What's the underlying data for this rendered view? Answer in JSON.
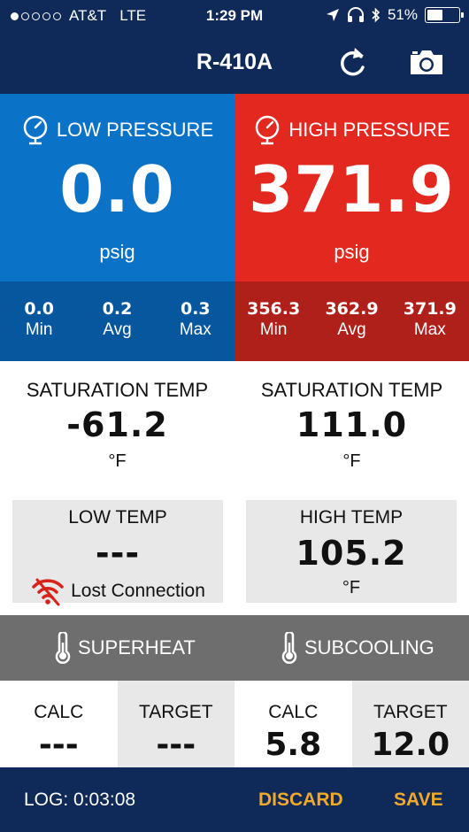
{
  "status_bar": {
    "carrier": "AT&T",
    "network": "LTE",
    "time": "1:29 PM",
    "battery": "51%",
    "battery_level": 0.51,
    "signal_dots_filled": 1,
    "signal_dots_total": 5,
    "icons": [
      "location-arrow-icon",
      "headphones-icon",
      "bluetooth-icon",
      "battery-icon"
    ]
  },
  "nav": {
    "title": "R-410A",
    "icons": [
      "refresh-icon",
      "camera-icon"
    ]
  },
  "low_pressure": {
    "label": "LOW PRESSURE",
    "value": "0.0",
    "unit": "psig",
    "stats": [
      {
        "value": "0.0",
        "label": "Min"
      },
      {
        "value": "0.2",
        "label": "Avg"
      },
      {
        "value": "0.3",
        "label": "Max"
      }
    ]
  },
  "high_pressure": {
    "label": "HIGH PRESSURE",
    "value": "371.9",
    "unit": "psig",
    "stats": [
      {
        "value": "356.3",
        "label": "Min"
      },
      {
        "value": "362.9",
        "label": "Avg"
      },
      {
        "value": "371.9",
        "label": "Max"
      }
    ]
  },
  "saturation": {
    "low": {
      "label": "SATURATION TEMP",
      "value": "-61.2",
      "unit": "°F"
    },
    "high": {
      "label": "SATURATION TEMP",
      "value": "111.0",
      "unit": "°F"
    }
  },
  "temps": {
    "low": {
      "label": "LOW TEMP",
      "value": "---",
      "status": "Lost Connection"
    },
    "high": {
      "label": "HIGH TEMP",
      "value": "105.2",
      "unit": "°F"
    }
  },
  "sections": {
    "superheat": "SUPERHEAT",
    "subcooling": "SUBCOOLING"
  },
  "calc_row": [
    {
      "label": "CALC",
      "value": "---"
    },
    {
      "label": "TARGET",
      "value": "---"
    },
    {
      "label": "CALC",
      "value": "5.8"
    },
    {
      "label": "TARGET",
      "value": "12.0"
    }
  ],
  "bottom": {
    "log": "LOG: 0:03:08",
    "discard": "DISCARD",
    "save": "SAVE"
  },
  "colors": {
    "navy": "#0f2a58",
    "low_blue": "#0a72c7",
    "low_blue_dark": "#06579e",
    "high_red": "#e3281f",
    "high_red_dark": "#b0201a",
    "section_gray": "#6e6e6e",
    "action_orange": "#f0a92a"
  }
}
